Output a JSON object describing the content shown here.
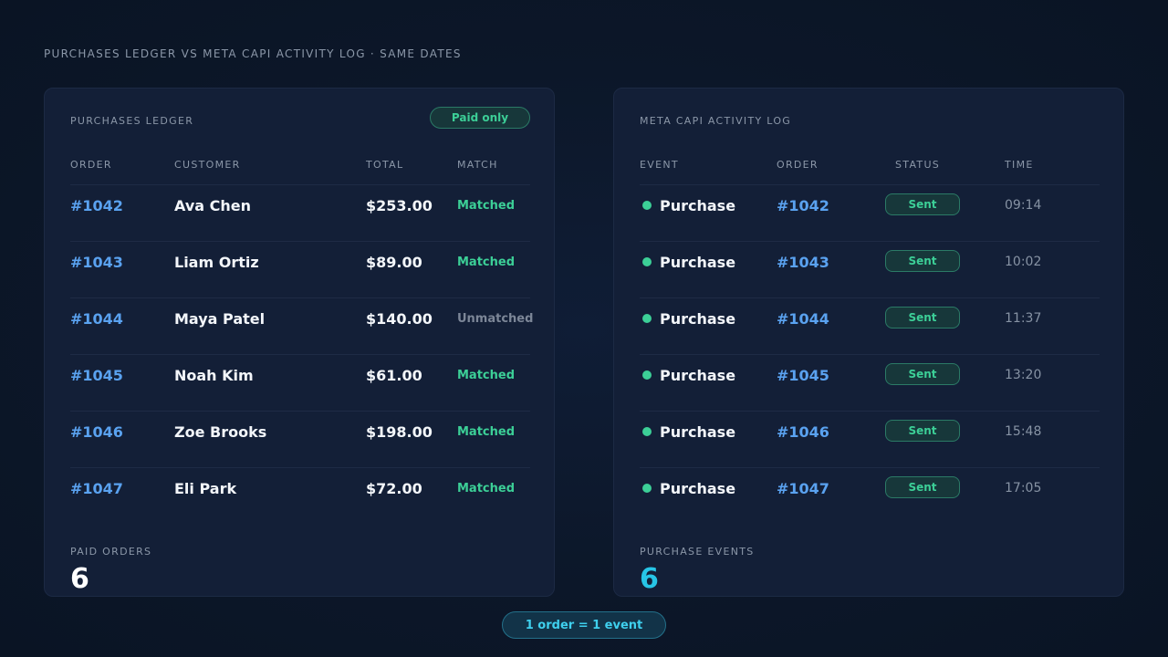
{
  "page": {
    "heading": "PURCHASES LEDGER VS META CAPI ACTIVITY LOG · SAME DATES",
    "footer_badge": "1 order = 1 event"
  },
  "ledger": {
    "title": "PURCHASES LEDGER",
    "filter_badge": "Paid only",
    "columns": [
      "ORDER",
      "CUSTOMER",
      "TOTAL",
      "MATCH"
    ],
    "rows": [
      {
        "order": "#1042",
        "customer": "Ava Chen",
        "total": "$253.00",
        "match": "Matched"
      },
      {
        "order": "#1043",
        "customer": "Liam Ortiz",
        "total": "$89.00",
        "match": "Matched"
      },
      {
        "order": "#1044",
        "customer": "Maya Patel",
        "total": "$140.00",
        "match": "Unmatched"
      },
      {
        "order": "#1045",
        "customer": "Noah Kim",
        "total": "$61.00",
        "match": "Matched"
      },
      {
        "order": "#1046",
        "customer": "Zoe Brooks",
        "total": "$198.00",
        "match": "Matched"
      },
      {
        "order": "#1047",
        "customer": "Eli Park",
        "total": "$72.00",
        "match": "Matched"
      }
    ],
    "stat_label": "PAID ORDERS",
    "stat_value": "6"
  },
  "capi": {
    "title": "META CAPI ACTIVITY LOG",
    "columns": [
      "EVENT",
      "ORDER",
      "STATUS",
      "TIME"
    ],
    "rows": [
      {
        "event": "Purchase",
        "order": "#1042",
        "status": "Sent",
        "time": "09:14"
      },
      {
        "event": "Purchase",
        "order": "#1043",
        "status": "Sent",
        "time": "10:02"
      },
      {
        "event": "Purchase",
        "order": "#1044",
        "status": "Sent",
        "time": "11:37"
      },
      {
        "event": "Purchase",
        "order": "#1045",
        "status": "Sent",
        "time": "13:20"
      },
      {
        "event": "Purchase",
        "order": "#1046",
        "status": "Sent",
        "time": "15:48"
      },
      {
        "event": "Purchase",
        "order": "#1047",
        "status": "Sent",
        "time": "17:05"
      }
    ],
    "stat_label": "PURCHASE EVENTS",
    "stat_value": "6"
  },
  "colors": {
    "background": "#0c1729",
    "panel": "#131f37",
    "accent_green": "#3ccf97",
    "accent_blue": "#5aa2f0",
    "accent_cyan": "#27c5e6",
    "muted": "#8b97a8"
  },
  "icons": {
    "status_dot": "status-dot-icon"
  }
}
